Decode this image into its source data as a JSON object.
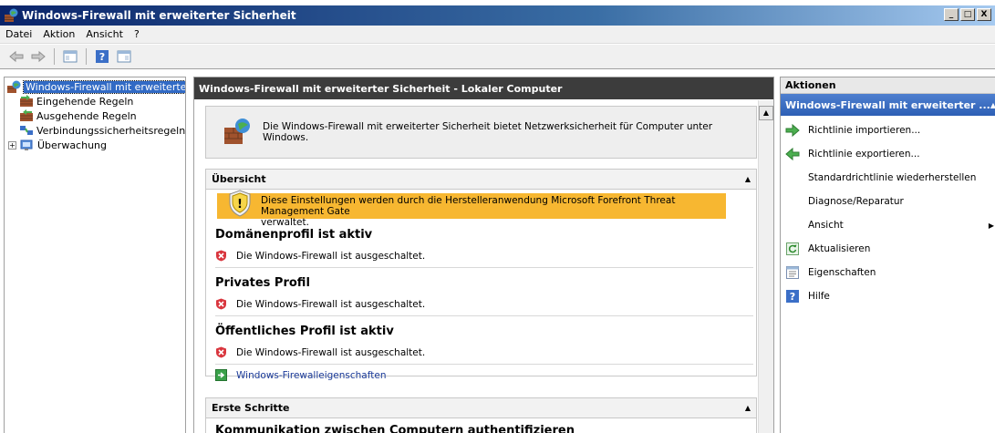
{
  "window": {
    "title": "Windows-Firewall mit erweiterter Sicherheit",
    "buttons": [
      "_",
      "□",
      "X"
    ]
  },
  "menu": [
    "Datei",
    "Aktion",
    "Ansicht",
    "?"
  ],
  "tree": {
    "items": [
      {
        "label": "Windows-Firewall mit erweiterter S",
        "icon": "firewall-icon"
      },
      {
        "label": "Eingehende Regeln",
        "icon": "inbound-rules-icon"
      },
      {
        "label": "Ausgehende Regeln",
        "icon": "outbound-rules-icon"
      },
      {
        "label": "Verbindungssicherheitsregeln",
        "icon": "connection-security-icon"
      },
      {
        "label": "Überwachung",
        "icon": "monitoring-icon",
        "expander": "+"
      }
    ]
  },
  "center": {
    "header": "Windows-Firewall mit erweiterter Sicherheit - Lokaler Computer",
    "intro": "Die Windows-Firewall mit erweiterter Sicherheit bietet Netzwerksicherheit für Computer unter Windows.",
    "overview": {
      "title": "Übersicht",
      "banner_line1": "Diese Einstellungen werden durch die Herstelleranwendung Microsoft Forefront Threat Management Gate",
      "banner_line2": "verwaltet.",
      "profiles": [
        {
          "title": "Domänenprofil ist aktiv",
          "status": "Die Windows-Firewall ist ausgeschaltet."
        },
        {
          "title": "Privates Profil",
          "status": "Die Windows-Firewall ist ausgeschaltet."
        },
        {
          "title": "Öffentliches Profil ist aktiv",
          "status": "Die Windows-Firewall ist ausgeschaltet."
        }
      ],
      "link": "Windows-Firewalleigenschaften"
    },
    "getting_started": {
      "title": "Erste Schritte",
      "first_item": "Kommunikation zwischen Computern authentifizieren"
    }
  },
  "actions": {
    "header": "Aktionen",
    "subheader": "Windows-Firewall mit erweiterter ...",
    "items": [
      {
        "label": "Richtlinie importieren...",
        "icon": "import-icon"
      },
      {
        "label": "Richtlinie exportieren...",
        "icon": "export-icon"
      },
      {
        "label": "Standardrichtlinie wiederherstellen",
        "icon": ""
      },
      {
        "label": "Diagnose/Reparatur",
        "icon": ""
      },
      {
        "label": "Ansicht",
        "icon": "",
        "submenu": true
      },
      {
        "label": "Aktualisieren",
        "icon": "refresh-icon"
      },
      {
        "label": "Eigenschaften",
        "icon": "properties-icon"
      },
      {
        "label": "Hilfe",
        "icon": "help-icon"
      }
    ]
  },
  "colors": {
    "title_bar": "#0a246a",
    "selection": "#316ac5",
    "warning_banner": "#f7b731",
    "actions_subheader": "#3a6cc0",
    "center_header": "#3c3c3c",
    "link": "#1a3a99"
  }
}
